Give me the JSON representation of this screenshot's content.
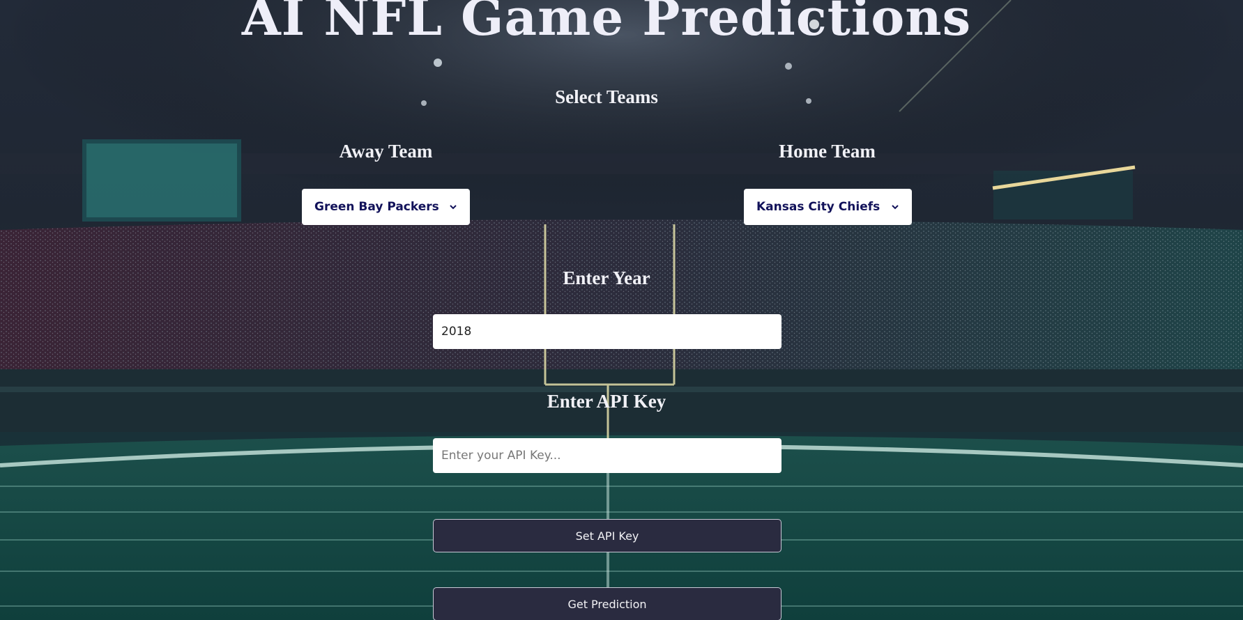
{
  "page": {
    "title": "AI NFL Game Predictions"
  },
  "teams": {
    "heading": "Select Teams",
    "away": {
      "label": "Away Team",
      "selected": "Green Bay Packers"
    },
    "home": {
      "label": "Home Team",
      "selected": "Kansas City Chiefs"
    }
  },
  "year": {
    "label": "Enter Year",
    "value": "2018"
  },
  "api": {
    "label": "Enter API Key",
    "value": "",
    "placeholder": "Enter your API Key...",
    "set_button": "Set API Key"
  },
  "predict": {
    "button": "Get Prediction"
  },
  "icons": {
    "select_arrow": "chevron-down-icon"
  },
  "colors": {
    "title_text": "#eeeef8",
    "select_text": "#12125a",
    "button_bg": "#2a2b40",
    "field_bg": "#ffffff"
  }
}
